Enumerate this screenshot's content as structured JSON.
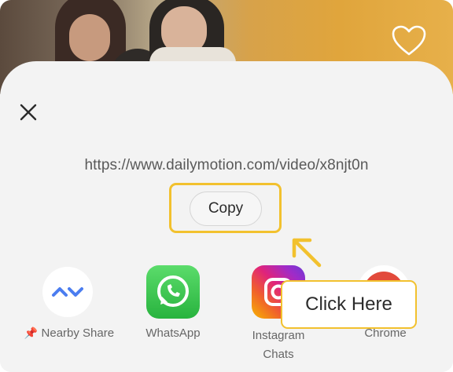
{
  "header": {
    "favorite_icon": "heart-icon"
  },
  "sheet": {
    "close_icon": "close-icon",
    "url": "https://www.dailymotion.com/video/x8njt0n",
    "copy_label": "Copy"
  },
  "apps": [
    {
      "name": "Nearby Share",
      "icon": "nearby-share-icon",
      "pinned": true
    },
    {
      "name": "WhatsApp",
      "icon": "whatsapp-icon"
    },
    {
      "name": "Instagram Chats",
      "line1": "Instagram",
      "line2": "Chats",
      "icon": "instagram-icon"
    },
    {
      "name": "Chrome",
      "icon": "chrome-icon"
    }
  ],
  "overlay": {
    "tooltip": "Click Here",
    "highlight_color": "#f2c12e"
  }
}
